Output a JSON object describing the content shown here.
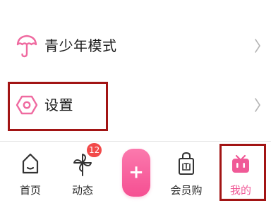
{
  "menu": {
    "items": [
      {
        "label": "青少年模式",
        "icon": "umbrella-icon"
      },
      {
        "label": "设置",
        "icon": "hexagon-settings-icon"
      }
    ]
  },
  "tabbar": {
    "tabs": [
      {
        "label": "首页",
        "icon": "home-icon"
      },
      {
        "label": "动态",
        "icon": "pinwheel-icon",
        "badge": "12"
      },
      {
        "label": "",
        "icon": "plus-icon"
      },
      {
        "label": "会员购",
        "icon": "shopping-bag-icon"
      },
      {
        "label": "我的",
        "icon": "tv-face-icon",
        "active": true
      }
    ],
    "plus_symbol": "+"
  },
  "colors": {
    "accent": "#f05a97",
    "highlight": "#a21414",
    "badge": "#f24a4a"
  }
}
